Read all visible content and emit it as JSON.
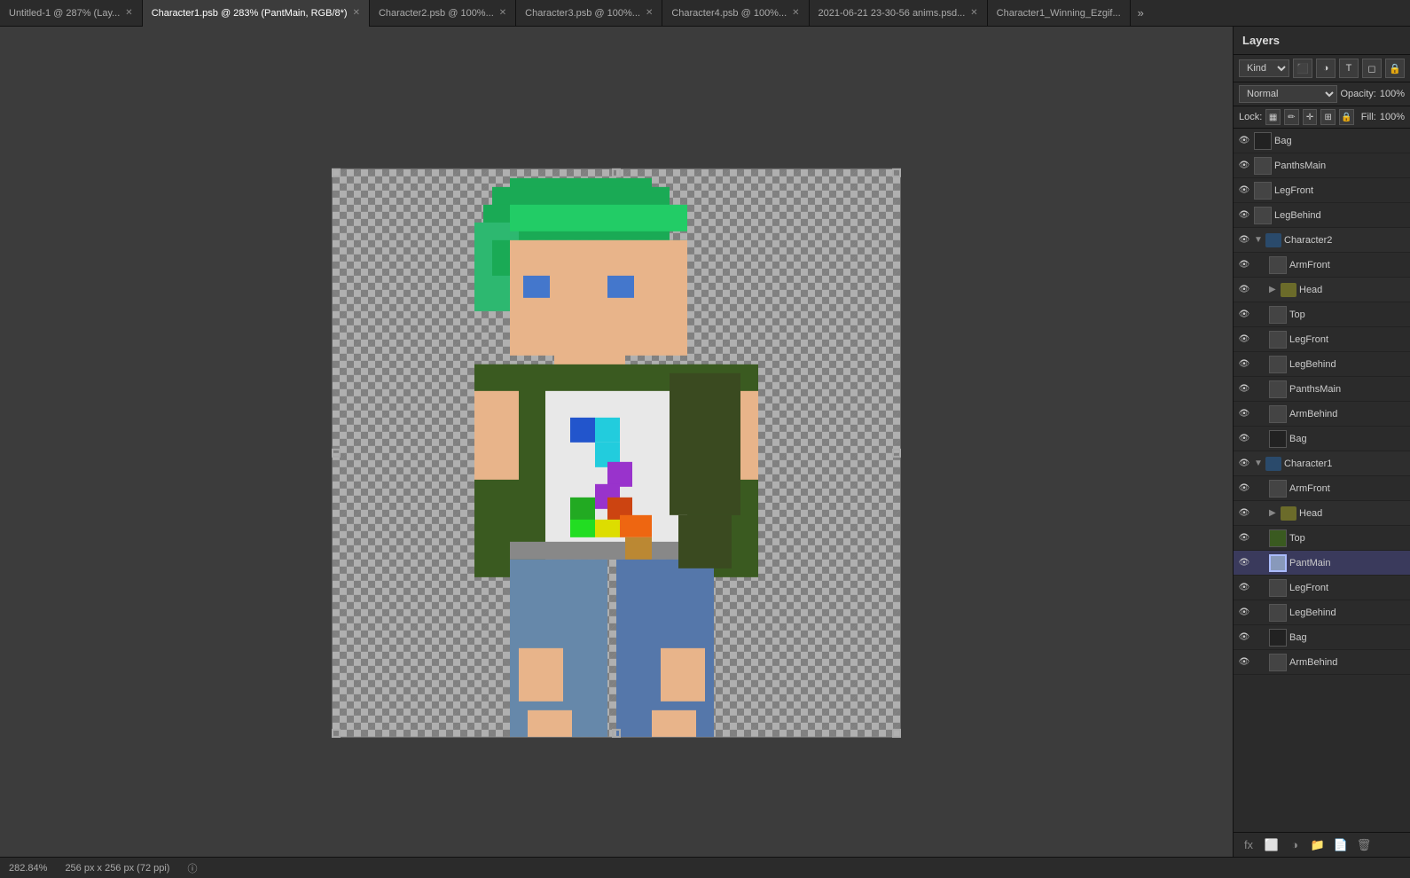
{
  "tabs": [
    {
      "label": "Untitled-1 @ 287% (Lay...",
      "active": false
    },
    {
      "label": "Character1.psb @ 283% (PantMain, RGB/8*)",
      "active": true
    },
    {
      "label": "Character2.psb @ 100%...",
      "active": false
    },
    {
      "label": "Character3.psb @ 100%...",
      "active": false
    },
    {
      "label": "Character4.psb @ 100%...",
      "active": false
    },
    {
      "label": "2021-06-21 23-30-56 anims.psd...",
      "active": false
    },
    {
      "label": "Character1_Winning_Ezgif...",
      "active": false
    }
  ],
  "layers_panel": {
    "title": "Layers",
    "kind_label": "Kind",
    "blend_mode": "Normal",
    "opacity_label": "Opacity:",
    "opacity_value": "100%",
    "fill_label": "Fill:",
    "fill_value": "100%",
    "lock_label": "Lock:"
  },
  "layers": [
    {
      "id": 1,
      "name": "Bag",
      "type": "layer",
      "indent": 0,
      "visible": true,
      "active": false,
      "thumb": "dark"
    },
    {
      "id": 2,
      "name": "PanthsMain",
      "type": "layer",
      "indent": 0,
      "visible": true,
      "active": false,
      "thumb": "normal"
    },
    {
      "id": 3,
      "name": "LegFront",
      "type": "layer",
      "indent": 0,
      "visible": true,
      "active": false,
      "thumb": "normal"
    },
    {
      "id": 4,
      "name": "LegBehind",
      "type": "layer",
      "indent": 0,
      "visible": true,
      "active": false,
      "thumb": "normal"
    },
    {
      "id": 5,
      "name": "Character2",
      "type": "group",
      "indent": 0,
      "visible": true,
      "active": false,
      "expanded": true
    },
    {
      "id": 6,
      "name": "ArmFront",
      "type": "layer",
      "indent": 1,
      "visible": true,
      "active": false,
      "thumb": "normal"
    },
    {
      "id": 7,
      "name": "Head",
      "type": "group",
      "indent": 1,
      "visible": true,
      "active": false,
      "expanded": false
    },
    {
      "id": 8,
      "name": "Top",
      "type": "layer",
      "indent": 1,
      "visible": true,
      "active": false,
      "thumb": "normal"
    },
    {
      "id": 9,
      "name": "LegFront",
      "type": "layer",
      "indent": 1,
      "visible": true,
      "active": false,
      "thumb": "normal"
    },
    {
      "id": 10,
      "name": "LegBehind",
      "type": "layer",
      "indent": 1,
      "visible": true,
      "active": false,
      "thumb": "normal"
    },
    {
      "id": 11,
      "name": "PanthsMain",
      "type": "layer",
      "indent": 1,
      "visible": true,
      "active": false,
      "thumb": "normal"
    },
    {
      "id": 12,
      "name": "ArmBehind",
      "type": "layer",
      "indent": 1,
      "visible": true,
      "active": false,
      "thumb": "normal"
    },
    {
      "id": 13,
      "name": "Bag",
      "type": "layer",
      "indent": 1,
      "visible": true,
      "active": false,
      "thumb": "dark"
    },
    {
      "id": 14,
      "name": "Character1",
      "type": "group",
      "indent": 0,
      "visible": true,
      "active": false,
      "expanded": true
    },
    {
      "id": 15,
      "name": "ArmFront",
      "type": "layer",
      "indent": 1,
      "visible": true,
      "active": false,
      "thumb": "normal"
    },
    {
      "id": 16,
      "name": "Head",
      "type": "group",
      "indent": 1,
      "visible": true,
      "active": false,
      "expanded": false
    },
    {
      "id": 17,
      "name": "Top",
      "type": "layer",
      "indent": 1,
      "visible": true,
      "active": false,
      "thumb": "special"
    },
    {
      "id": 18,
      "name": "PantMain",
      "type": "layer",
      "indent": 1,
      "visible": true,
      "active": true,
      "thumb": "active"
    },
    {
      "id": 19,
      "name": "LegFront",
      "type": "layer",
      "indent": 1,
      "visible": true,
      "active": false,
      "thumb": "normal"
    },
    {
      "id": 20,
      "name": "LegBehind",
      "type": "layer",
      "indent": 1,
      "visible": true,
      "active": false,
      "thumb": "normal"
    },
    {
      "id": 21,
      "name": "Bag",
      "type": "layer",
      "indent": 1,
      "visible": true,
      "active": false,
      "thumb": "dark"
    },
    {
      "id": 22,
      "name": "ArmBehind",
      "type": "layer",
      "indent": 1,
      "visible": true,
      "active": false,
      "thumb": "normal"
    }
  ],
  "status_bar": {
    "zoom": "282.84%",
    "dimensions": "256 px x 256 px (72 ppi)",
    "info_icon": "ⓘ"
  }
}
